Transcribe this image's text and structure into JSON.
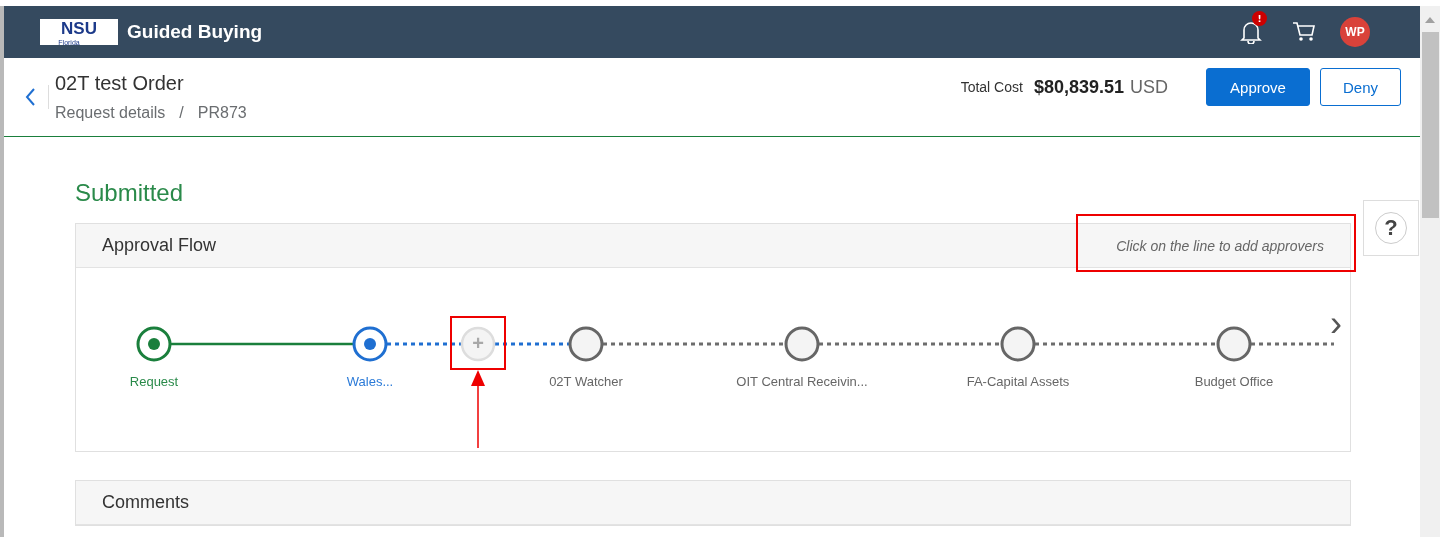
{
  "header": {
    "logo": {
      "main": "NSU",
      "sub": "Florida"
    },
    "title": "Guided Buying",
    "notification_badge": "!",
    "avatar": "WP"
  },
  "request": {
    "title": "02T test Order",
    "breadcrumb": [
      "Request details",
      "PR873"
    ],
    "breadcrumb_separator": "/",
    "total_label": "Total Cost",
    "total_amount": "$80,839.51",
    "currency": "USD",
    "buttons": [
      {
        "label": "Approve",
        "kind": "primary"
      },
      {
        "label": "Deny",
        "kind": "secondary"
      }
    ]
  },
  "status": "Submitted",
  "help": "?",
  "approval_flow": {
    "title": "Approval Flow",
    "hint": "Click on the line to add approvers",
    "next": "›",
    "steps": [
      {
        "kind": "done",
        "label": "Request"
      },
      {
        "kind": "current",
        "label": "Wales..."
      },
      {
        "kind": "add",
        "label": "+"
      },
      {
        "kind": "pending",
        "label": "02T Watcher"
      },
      {
        "kind": "pending",
        "label": "OIT Central Receivin..."
      },
      {
        "kind": "pending",
        "label": "FA-Capital Assets"
      },
      {
        "kind": "pending",
        "label": "Budget Office"
      }
    ]
  },
  "comments": {
    "title": "Comments"
  }
}
